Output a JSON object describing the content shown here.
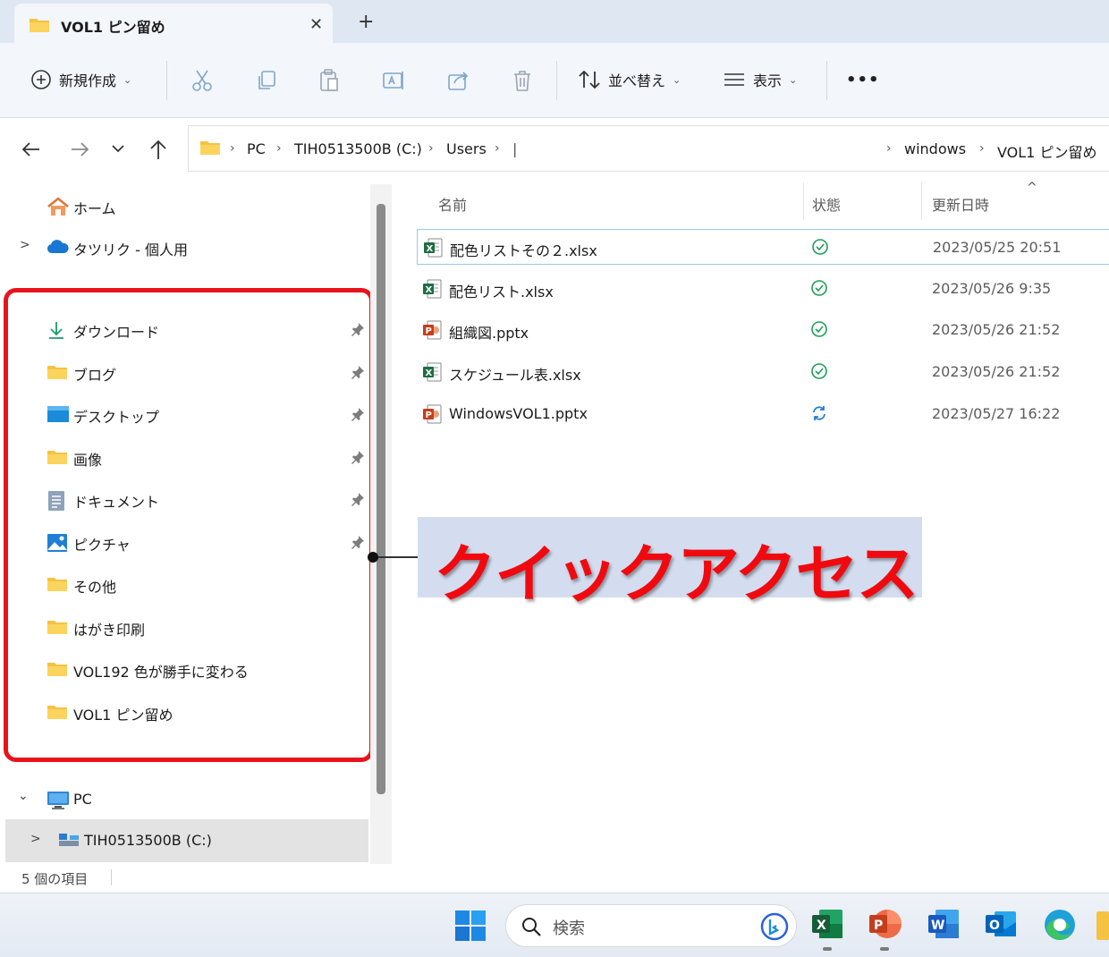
{
  "window": {
    "tab_title": "VOL1 ピン留め",
    "tab_close": "✕",
    "new_tab": "+"
  },
  "toolbar": {
    "new_label": "新規作成",
    "sort_label": "並べ替え",
    "view_label": "表示",
    "more_label": "•••",
    "chevron": "⌄"
  },
  "address": {
    "crumbs": [
      "PC",
      "TIH0513500B (C:)",
      "Users",
      "|",
      "windows",
      "VOL1 ピン留め"
    ],
    "separator": "›"
  },
  "sidebar": {
    "home": "ホーム",
    "onedrive": "タツリク - 個人用",
    "quick_access": [
      {
        "label": "ダウンロード",
        "icon": "download-icon",
        "pinned": true
      },
      {
        "label": "ブログ",
        "icon": "folder-icon",
        "pinned": true
      },
      {
        "label": "デスクトップ",
        "icon": "desktop-icon",
        "pinned": true
      },
      {
        "label": "画像",
        "icon": "folder-icon",
        "pinned": true
      },
      {
        "label": "ドキュメント",
        "icon": "documents-icon",
        "pinned": true
      },
      {
        "label": "ピクチャ",
        "icon": "pictures-icon",
        "pinned": true
      },
      {
        "label": "その他",
        "icon": "folder-icon",
        "pinned": false
      },
      {
        "label": "はがき印刷",
        "icon": "folder-icon",
        "pinned": false
      },
      {
        "label": "VOL192 色が勝手に変わる",
        "icon": "folder-icon",
        "pinned": false
      },
      {
        "label": "VOL1 ピン留め",
        "icon": "folder-icon",
        "pinned": false
      }
    ],
    "pc": "PC",
    "drive": "TIH0513500B (C:)",
    "expand_glyph": ">",
    "collapse_glyph": "⌄"
  },
  "file_list": {
    "columns": {
      "name": "名前",
      "status": "状態",
      "modified": "更新日時"
    },
    "sort_glyph": "^",
    "files": [
      {
        "name": "配色リストその２.xlsx",
        "type": "excel",
        "status": "synced",
        "modified": "2023/05/25 20:51"
      },
      {
        "name": "配色リスト.xlsx",
        "type": "excel",
        "status": "synced",
        "modified": "2023/05/26 9:35"
      },
      {
        "name": "組織図.pptx",
        "type": "powerpoint",
        "status": "synced",
        "modified": "2023/05/26 21:52"
      },
      {
        "name": "スケジュール表.xlsx",
        "type": "excel",
        "status": "synced",
        "modified": "2023/05/26 21:52"
      },
      {
        "name": "WindowsVOL1.pptx",
        "type": "powerpoint",
        "status": "syncing",
        "modified": "2023/05/27 16:22"
      }
    ]
  },
  "callout": {
    "text": "クイックアクセス",
    "color": "#f00a10",
    "box_color": "#e8141c"
  },
  "status_bar": {
    "item_count": "5 個の項目"
  },
  "taskbar": {
    "search_placeholder": "検索",
    "apps": [
      "start-icon",
      "excel-icon",
      "powerpoint-icon",
      "word-icon",
      "outlook-icon",
      "edge-icon"
    ]
  }
}
